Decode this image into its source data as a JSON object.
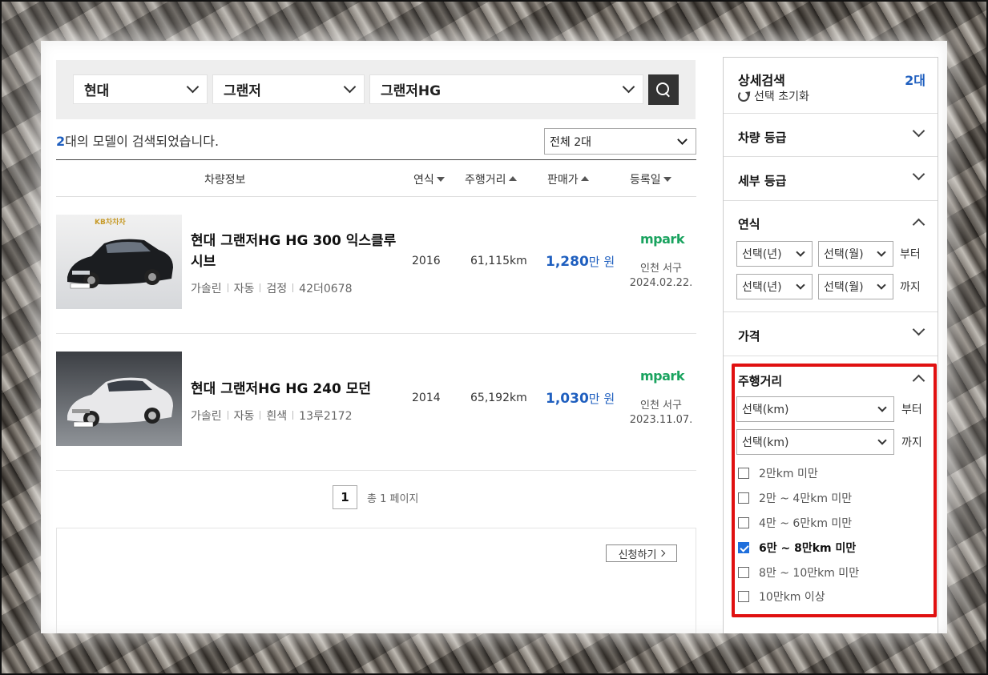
{
  "search": {
    "maker": "현대",
    "model": "그랜저",
    "submodel": "그랜저HG"
  },
  "results": {
    "count_num": "2",
    "count_text": "대의 모델이 검색되었습니다.",
    "count_select": "전체 2대"
  },
  "table_header": {
    "info": "차량정보",
    "year": "연식",
    "mileage": "주행거리",
    "price": "판매가",
    "date": "등록일"
  },
  "cars": [
    {
      "name": "현대 그랜저HG HG 300 익스클루시브",
      "fuel": "가솔린",
      "trans": "자동",
      "color": "검정",
      "plate": "42더0678",
      "year": "2016",
      "km": "61,115km",
      "price": "1,280",
      "price_unit": "만 원",
      "dealer": "mpark",
      "location": "인천 서구",
      "date": "2024.02.22.",
      "thumb_watermark": "KB차차차",
      "car_color_hex": "#1b1d20"
    },
    {
      "name": "현대 그랜저HG HG 240 모던",
      "fuel": "가솔린",
      "trans": "자동",
      "color": "흰색",
      "plate": "13루2172",
      "year": "2014",
      "km": "65,192km",
      "price": "1,030",
      "price_unit": "만 원",
      "dealer": "mpark",
      "location": "인천 서구",
      "date": "2023.11.07.",
      "car_color_hex": "#e8e8ea"
    }
  ],
  "pager": {
    "current": "1",
    "total": "총 1 페이지"
  },
  "apply": {
    "label": "신청하기"
  },
  "sidebar": {
    "title": "상세검색",
    "count": "2대",
    "reset": "선택 초기화",
    "grade": "차량 등급",
    "sub_grade": "세부 등급",
    "year": {
      "title": "연식",
      "from_year": "선택(년)",
      "from_month": "선택(월)",
      "from_suffix": "부터",
      "to_year": "선택(년)",
      "to_month": "선택(월)",
      "to_suffix": "까지"
    },
    "price": "가격",
    "mileage": {
      "title": "주행거리",
      "from": "선택(km)",
      "from_suffix": "부터",
      "to": "선택(km)",
      "to_suffix": "까지",
      "options": [
        {
          "label": "2만km 미만",
          "checked": false
        },
        {
          "label": "2만 ~ 4만km 미만",
          "checked": false
        },
        {
          "label": "4만 ~ 6만km 미만",
          "checked": false
        },
        {
          "label": "6만 ~ 8만km 미만",
          "checked": true
        },
        {
          "label": "8만 ~ 10만km 미만",
          "checked": false
        },
        {
          "label": "10만km 이상",
          "checked": false
        }
      ]
    }
  },
  "colors": {
    "accent_blue": "#1f5fbf",
    "mpark_green": "#1aa35f",
    "highlight_red": "#e01010",
    "checkbox_blue": "#1f6fdc"
  }
}
